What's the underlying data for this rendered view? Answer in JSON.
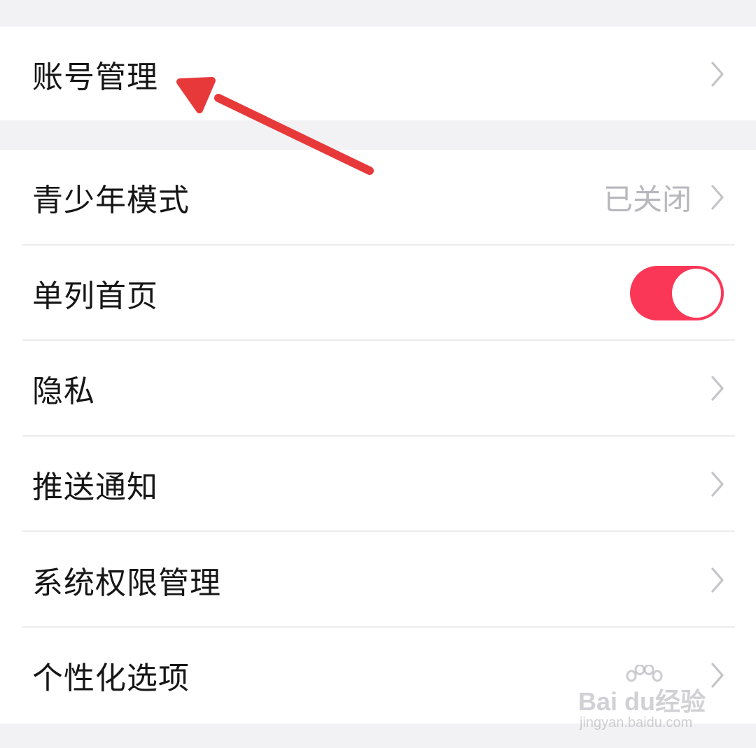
{
  "account_group": {
    "item": {
      "label": "账号管理",
      "icon": "chevron-right-icon"
    }
  },
  "settings_group": {
    "items": [
      {
        "label": "青少年模式",
        "value": "已关闭",
        "icon": "chevron-right-icon"
      },
      {
        "label": "单列首页",
        "toggle_on": true
      },
      {
        "label": "隐私",
        "icon": "chevron-right-icon"
      },
      {
        "label": "推送通知",
        "icon": "chevron-right-icon"
      },
      {
        "label": "系统权限管理",
        "icon": "chevron-right-icon"
      },
      {
        "label": "个性化选项",
        "icon": "chevron-right-icon"
      }
    ]
  },
  "annotation": {
    "icon": "red-arrow-icon",
    "color": "#e8393a"
  },
  "watermark": {
    "brand": "Bai  du经验",
    "url": "jingyan.baidu.com"
  },
  "colors": {
    "background": "#f2f2f4",
    "card": "#ffffff",
    "toggle_on": "#fb3758",
    "secondary_text": "#b8b8bc",
    "chevron": "#c4c4c8"
  }
}
